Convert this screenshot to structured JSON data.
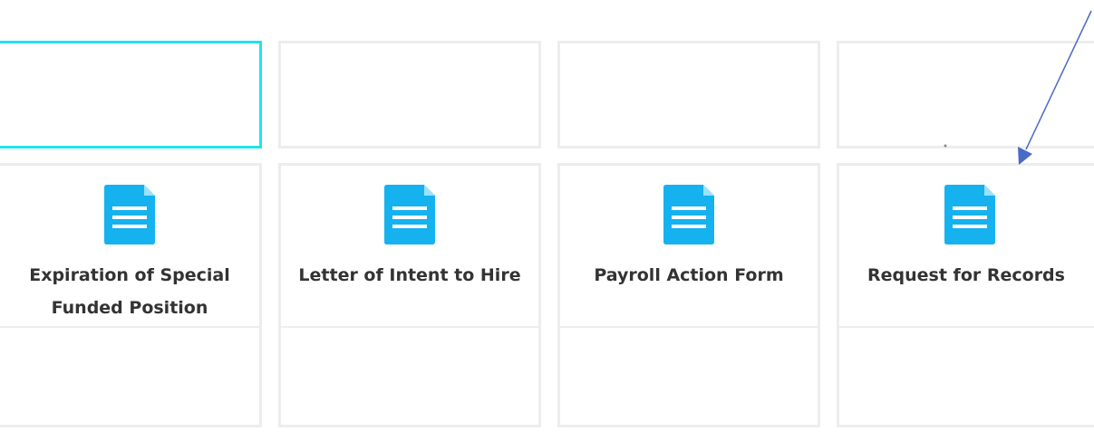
{
  "colors": {
    "icon": "#15b2ef",
    "selected_border": "#1fe3ef",
    "card_border": "#ededed",
    "title_text": "#333333",
    "annotation_arrow": "#4a6bc7"
  },
  "icon_name": "document-icon",
  "cards": [
    {
      "title": "Expiration of Special Funded Position"
    },
    {
      "title": "Letter of Intent to Hire"
    },
    {
      "title": "Payroll Action Form"
    },
    {
      "title": "Request for Records"
    }
  ]
}
